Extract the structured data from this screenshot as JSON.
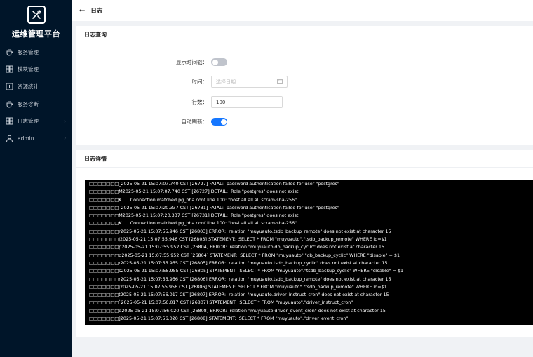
{
  "sidebar": {
    "app_title": "运维管理平台",
    "items": [
      {
        "label": "服务管理",
        "icon": "cup-icon"
      },
      {
        "label": "模块管理",
        "icon": "grid-icon"
      },
      {
        "label": "资源统计",
        "icon": "bar-chart-icon"
      },
      {
        "label": "服务诊断",
        "icon": "cup-icon"
      },
      {
        "label": "日志管理",
        "icon": "grid-icon"
      },
      {
        "label": "admin",
        "icon": "user-icon"
      }
    ]
  },
  "header": {
    "title": "日志"
  },
  "query": {
    "title": "日志查询",
    "show_timestamp_label": "显示时间戳：",
    "show_timestamp_on": false,
    "time_label": "时间：",
    "date_placeholder": "选择日期",
    "lines_label": "行数：",
    "lines_value": "100",
    "auto_refresh_label": "自动刷新：",
    "auto_refresh_on": true
  },
  "details": {
    "title": "日志详情",
    "lines": [
      "□□□□□□□_2025-05-21 15:07:07.740 CST [26727] FATAL:  password authentication failed for user \"postgres\"",
      "□□□□□□□M2025-05-21 15:07:07.740 CST [26727] DETAIL:  Role \"postgres\" does not exist.",
      "□□□□□□□K      Connection matched pg_hba.conf line 100: \"host all all all scram-sha-256\"",
      "□□□□□□□_2025-05-21 15:07:20.337 CST [26731] FATAL:  password authentication failed for user \"postgres\"",
      "□□□□□□□M2025-05-21 15:07:20.337 CST [26731] DETAIL:  Role \"postgres\" does not exist.",
      "□□□□□□□K      Connection matched pg_hba.conf line 100: \"host all all all scram-sha-256\"",
      "□□□□□□□r2025-05-21 15:07:55.946 CST [26803] ERROR:  relation \"muyuauto.tsdb_backup_remote\" does not exist at character 15",
      "□□□□□□□j2025-05-21 15:07:55.946 CST [26803] STATEMENT:  SELECT * FROM \"muyuauto\".\"tsdb_backup_remote\" WHERE id=$1",
      "□□□□□□□p2025-05-21 15:07:55.952 CST [26804] ERROR:  relation \"muyuauto.db_backup_cyclic\" does not exist at character 15",
      "□□□□□□□q2025-05-21 15:07:55.952 CST [26804] STATEMENT:  SELECT * FROM \"muyuauto\".\"db_backup_cyclic\" WHERE \"disable\" = $1",
      "□□□□□□□r2025-05-21 15:07:55.955 CST [26805] ERROR:  relation \"muyuauto.tsdb_backup_cyclic\" does not exist at character 15",
      "□□□□□□□s2025-05-21 15:07:55.955 CST [26805] STATEMENT:  SELECT * FROM \"muyuauto\".\"tsdb_backup_cyclic\" WHERE \"disable\" = $1",
      "□□□□□□□r2025-05-21 15:07:55.956 CST [26806] ERROR:  relation \"muyuauto.tsdb_backup_remote\" does not exist at character 15",
      "□□□□□□□j2025-05-21 15:07:55.956 CST [26806] STATEMENT:  SELECT * FROM \"muyuauto\".\"tsdb_backup_remote\" WHERE id=$1",
      "□□□□□□□t2025-05-21 15:07:56.017 CST [26807] ERROR:  relation \"muyuauto.driver_instruct_cron\" does not exist at character 15",
      "□□□□□□□`2025-05-21 15:07:56.017 CST [26807] STATEMENT:  SELECT * FROM \"muyuauto\".\"driver_instruct_cron\"",
      "□□□□□□□q2025-05-21 15:07:56.020 CST [26808] ERROR:  relation \"muyuauto.driver_event_cron\" does not exist at character 15",
      "□□□□□□□]2025-05-21 15:07:56.020 CST [26808] STATEMENT:  SELECT * FROM \"muyuauto\".\"driver_event_cron\""
    ]
  },
  "colors": {
    "sidebar_bg": "#001529",
    "accent": "#1677ff",
    "log_bg": "#000000"
  }
}
